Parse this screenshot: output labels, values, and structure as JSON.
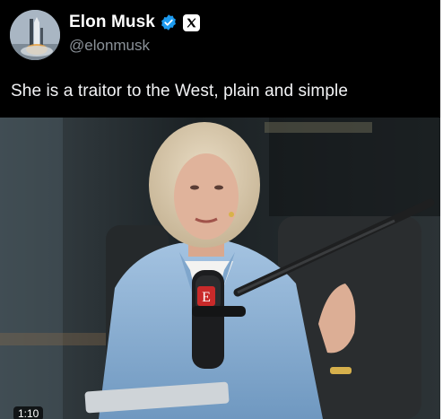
{
  "author": {
    "display_name": "Elon Musk",
    "handle": "@elonmusk",
    "verified": true,
    "avatar_icon": "rocket-launch-avatar",
    "affiliation_icon": "x-logo-icon"
  },
  "post": {
    "text": "She is a traitor to the West, plain and simple"
  },
  "media": {
    "type": "video",
    "duration": "1:10",
    "mic_logo_letter": "E"
  },
  "colors": {
    "background": "#000000",
    "name": "#ffffff",
    "handle": "#8b9299",
    "verified_badge": "#1d9bf0",
    "blazer": "#8fb6d9"
  }
}
